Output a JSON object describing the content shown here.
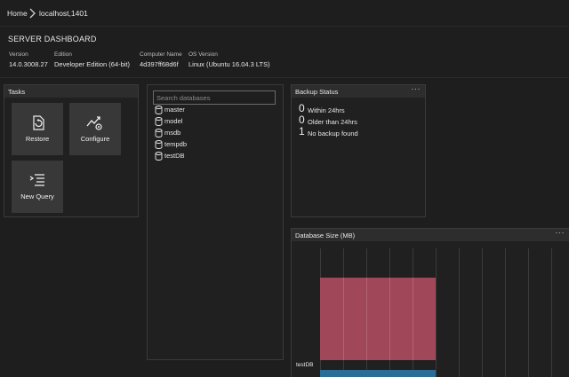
{
  "breadcrumb": {
    "home": "Home",
    "server": "localhost,1401"
  },
  "dashboard": {
    "title": "SERVER DASHBOARD",
    "properties": [
      {
        "label": "Version",
        "value": "14.0.3008.27"
      },
      {
        "label": "Edition",
        "value": "Developer Edition (64-bit)"
      },
      {
        "label": "Computer Name",
        "value": "4d397ff68d6f"
      },
      {
        "label": "OS Version",
        "value": "Linux (Ubuntu 16.04.3 LTS)"
      }
    ]
  },
  "tasks": {
    "title": "Tasks",
    "items": [
      {
        "label": "Restore",
        "icon": "restore-icon"
      },
      {
        "label": "Configure",
        "icon": "configure-icon"
      },
      {
        "label": "New Query",
        "icon": "new-query-icon"
      }
    ]
  },
  "databases": {
    "search_placeholder": "Search databases",
    "items": [
      "master",
      "model",
      "msdb",
      "tempdb",
      "testDB"
    ]
  },
  "backup": {
    "title": "Backup Status",
    "more": "···",
    "rows": [
      {
        "count": "0",
        "label": "Within 24hrs"
      },
      {
        "count": "0",
        "label": "Older than 24hrs"
      },
      {
        "count": "1",
        "label": "No backup found"
      }
    ]
  },
  "dbsize": {
    "title": "Database Size (MB)",
    "more": "···"
  },
  "chart_data": {
    "type": "bar",
    "orientation": "horizontal",
    "stacked": true,
    "categories": [
      "testDB"
    ],
    "series": [
      {
        "values": [
          8
        ],
        "color": "#a84a5e"
      },
      {
        "values": [
          24
        ],
        "color": "#2b6d96"
      }
    ],
    "xlim": [
      0,
      20
    ],
    "grid": true,
    "colors": {
      "accent_pink": "#a84a5e",
      "accent_blue": "#2b6d96"
    }
  }
}
